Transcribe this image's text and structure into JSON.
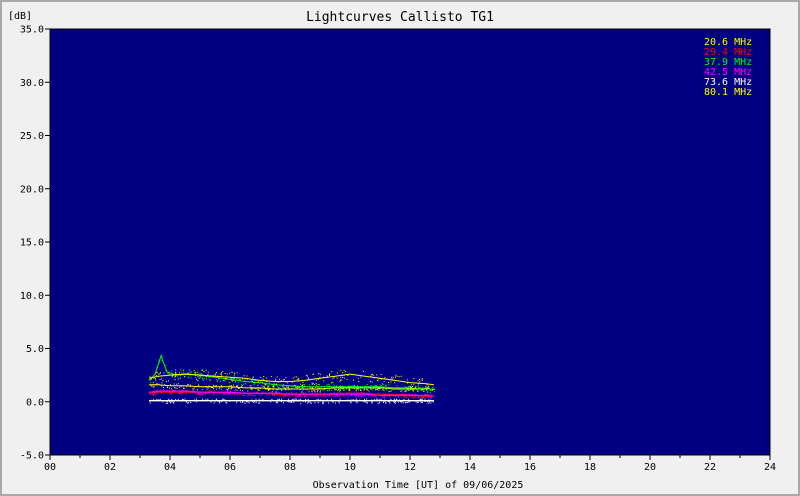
{
  "chart_data": {
    "type": "scatter",
    "title": "Lightcurves Callisto TG1",
    "ylabel": "[dB]",
    "xlabel": "Observation Time [UT] of 09/06/2025",
    "xlim": [
      0,
      24
    ],
    "ylim": [
      -5,
      35
    ],
    "x_ticks": [
      "00",
      "02",
      "04",
      "06",
      "08",
      "10",
      "12",
      "14",
      "16",
      "18",
      "20",
      "22",
      "24"
    ],
    "y_ticks": [
      "35.0",
      "30.0",
      "25.0",
      "20.0",
      "15.0",
      "10.0",
      "5.0",
      "0.0",
      "-5.0"
    ],
    "legend_position": "top-right",
    "plot_background": "#000080",
    "x_unit": "hours UT",
    "series": [
      {
        "name": "20.6 MHz",
        "color": "#ffff00",
        "x": [
          3.3,
          3.6,
          4.0,
          4.5,
          5.0,
          5.5,
          6.0,
          6.5,
          7.0,
          7.5,
          8.0,
          8.5,
          9.0,
          9.5,
          10.0,
          10.5,
          11.0,
          11.5,
          12.0,
          12.5,
          12.8
        ],
        "y": [
          1.6,
          1.6,
          1.5,
          1.5,
          1.4,
          1.4,
          1.4,
          1.3,
          1.3,
          1.2,
          1.2,
          1.2,
          1.2,
          1.3,
          1.3,
          1.3,
          1.3,
          1.2,
          1.2,
          1.2,
          1.2
        ]
      },
      {
        "name": "29.4 MHz",
        "color": "#ff0000",
        "x": [
          3.3,
          3.6,
          4.0,
          4.5,
          5.0,
          5.5,
          6.0,
          6.5,
          7.0,
          7.5,
          8.0,
          8.5,
          9.0,
          9.5,
          10.0,
          10.5,
          11.0,
          11.5,
          12.0,
          12.5,
          12.8
        ],
        "y": [
          0.8,
          0.9,
          0.9,
          0.9,
          0.9,
          0.9,
          0.8,
          0.8,
          0.8,
          0.7,
          0.7,
          0.7,
          0.7,
          0.7,
          0.8,
          0.8,
          0.7,
          0.7,
          0.6,
          0.5,
          0.5
        ]
      },
      {
        "name": "37.9 MHz",
        "color": "#00ff00",
        "x": [
          3.3,
          3.5,
          3.7,
          3.9,
          4.2,
          4.6,
          5.0,
          5.5,
          6.0,
          6.5,
          7.0,
          7.5,
          8.0,
          8.5,
          9.0,
          9.5,
          10.0,
          10.5,
          11.0,
          11.5,
          12.0,
          12.5,
          12.8
        ],
        "y": [
          2.0,
          2.6,
          4.3,
          2.8,
          2.5,
          2.6,
          2.5,
          2.3,
          2.1,
          1.9,
          1.8,
          1.6,
          1.5,
          1.4,
          1.4,
          1.4,
          1.4,
          1.4,
          1.4,
          1.3,
          1.3,
          1.2,
          1.2
        ]
      },
      {
        "name": "42.5 MHz",
        "color": "#ff00ff",
        "x": [
          3.3,
          3.6,
          4.0,
          4.5,
          5.0,
          5.5,
          6.0,
          6.5,
          7.0,
          7.5,
          8.0,
          8.5,
          9.0,
          9.5,
          10.0,
          10.5,
          11.0,
          11.5,
          12.0,
          12.5,
          12.8
        ],
        "y": [
          0.9,
          1.0,
          1.0,
          1.0,
          0.9,
          0.9,
          0.9,
          0.8,
          0.8,
          0.8,
          0.7,
          0.7,
          0.7,
          0.7,
          0.7,
          0.7,
          0.6,
          0.6,
          0.6,
          0.6,
          0.5
        ]
      },
      {
        "name": "73.6 MHz",
        "color": "#ffffff",
        "x": [
          3.3,
          3.6,
          4.0,
          4.5,
          5.0,
          5.5,
          6.0,
          6.5,
          7.0,
          7.5,
          8.0,
          8.5,
          9.0,
          9.5,
          10.0,
          10.5,
          11.0,
          11.5,
          12.0,
          12.5,
          12.8
        ],
        "y": [
          0.1,
          0.1,
          0.1,
          0.1,
          0.1,
          0.1,
          0.1,
          0.1,
          0.1,
          0.1,
          0.1,
          0.1,
          0.1,
          0.1,
          0.1,
          0.1,
          0.1,
          0.1,
          0.1,
          0.1,
          0.1
        ]
      },
      {
        "name": "80.1 MHz",
        "color": "#ffff00",
        "x": [
          3.3,
          3.6,
          4.0,
          4.5,
          5.0,
          5.5,
          6.0,
          6.5,
          7.0,
          7.5,
          8.0,
          8.5,
          9.0,
          9.5,
          10.0,
          10.5,
          11.0,
          11.5,
          12.0,
          12.5,
          12.8
        ],
        "y": [
          2.2,
          2.4,
          2.5,
          2.6,
          2.5,
          2.4,
          2.3,
          2.2,
          2.0,
          1.9,
          1.9,
          2.0,
          2.2,
          2.4,
          2.6,
          2.4,
          2.2,
          2.0,
          1.8,
          1.7,
          1.6
        ]
      }
    ]
  }
}
